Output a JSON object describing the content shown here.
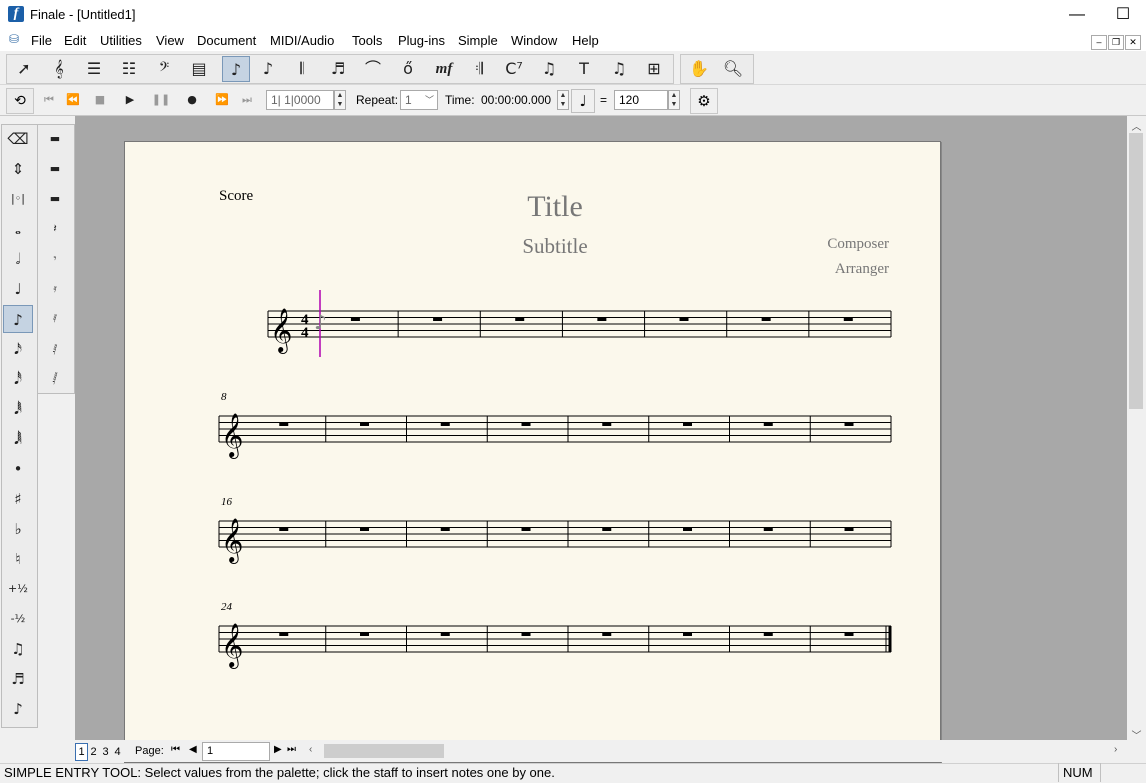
{
  "window": {
    "title": "Finale - [Untitled1]",
    "controls": {
      "minimize": "—",
      "maximize": "☐",
      "close": "✕"
    }
  },
  "menu": [
    {
      "label": "File"
    },
    {
      "label": "Edit"
    },
    {
      "label": "Utilities"
    },
    {
      "label": "View"
    },
    {
      "label": "Document"
    },
    {
      "label": "MIDI/Audio"
    },
    {
      "label": "Tools"
    },
    {
      "label": "Plug-ins"
    },
    {
      "label": "Simple"
    },
    {
      "label": "Window"
    },
    {
      "label": "Help"
    }
  ],
  "main_tools": [
    {
      "name": "selection-tool-icon",
      "glyph": "➚"
    },
    {
      "name": "staff-tool-icon",
      "glyph": "𝄞"
    },
    {
      "name": "smart-shape-staff-icon",
      "glyph": "☰"
    },
    {
      "name": "measure-tool-icon",
      "glyph": "☷"
    },
    {
      "name": "clef-tool-icon",
      "glyph": "𝄢"
    },
    {
      "name": "key-signature-tool-icon",
      "glyph": "▤"
    },
    {
      "name": "simple-entry-tool-icon",
      "glyph": "♪",
      "active": true
    },
    {
      "name": "speedy-entry-tool-icon",
      "glyph": "♪"
    },
    {
      "name": "tuplet-tool-icon",
      "glyph": "𝄃"
    },
    {
      "name": "tuplet-3-tool-icon",
      "glyph": "♬"
    },
    {
      "name": "smart-shape-tool-icon",
      "glyph": "⌒"
    },
    {
      "name": "articulation-tool-icon",
      "glyph": "ő"
    },
    {
      "name": "expression-tool-icon",
      "glyph": "mf",
      "serif": true
    },
    {
      "name": "repeat-tool-icon",
      "glyph": "𝄇"
    },
    {
      "name": "chord-tool-icon",
      "glyph": "C⁷"
    },
    {
      "name": "lyrics-tool-icon",
      "glyph": "♫"
    },
    {
      "name": "text-tool-icon",
      "glyph": "T"
    },
    {
      "name": "resize-tool-icon",
      "glyph": "♫"
    },
    {
      "name": "page-layout-tool-icon",
      "glyph": "⊞"
    },
    {
      "name": "hand-grabber-icon",
      "glyph": "✋"
    },
    {
      "name": "zoom-icon",
      "glyph": "🔍︎"
    }
  ],
  "playback": {
    "loop_glyph": "⟲",
    "buttons": [
      {
        "name": "rewind-start-icon",
        "glyph": "⏮",
        "on": false
      },
      {
        "name": "rewind-icon",
        "glyph": "⏪",
        "on": false
      },
      {
        "name": "stop-icon",
        "glyph": "■",
        "on": false
      },
      {
        "name": "play-icon",
        "glyph": "▶",
        "on": true
      },
      {
        "name": "pause-icon",
        "glyph": "❚❚",
        "on": false
      },
      {
        "name": "record-icon",
        "glyph": "●",
        "on": true
      },
      {
        "name": "fast-forward-icon",
        "glyph": "⏩",
        "on": false
      },
      {
        "name": "forward-end-icon",
        "glyph": "⏭",
        "on": false
      }
    ],
    "counter": "1|  1|0000",
    "repeat_label": "Repeat:",
    "repeat_value": "1",
    "time_label": "Time:",
    "time_value": "00:00:00.000",
    "tempo_equals": "=",
    "tempo_value": "120",
    "settings_glyph": "⚙"
  },
  "palette_main": [
    {
      "name": "eraser-icon",
      "glyph": "⌫"
    },
    {
      "name": "pitch-up-down-icon",
      "glyph": "⇕"
    },
    {
      "name": "breve-icon",
      "glyph": "|◦|"
    },
    {
      "name": "whole-note-icon",
      "glyph": "𝅝"
    },
    {
      "name": "half-note-icon",
      "glyph": "𝅗𝅥"
    },
    {
      "name": "quarter-note-icon",
      "glyph": "♩"
    },
    {
      "name": "eighth-note-icon",
      "glyph": "♪",
      "active": true
    },
    {
      "name": "sixteenth-note-icon",
      "glyph": "𝅘𝅥𝅯"
    },
    {
      "name": "thirty-second-note-icon",
      "glyph": "𝅘𝅥𝅰"
    },
    {
      "name": "sixty-fourth-note-icon",
      "glyph": "𝅘𝅥𝅱"
    },
    {
      "name": "one-twenty-eighth-note-icon",
      "glyph": "𝅘𝅥𝅲"
    },
    {
      "name": "dot-icon",
      "glyph": "•"
    },
    {
      "name": "sharp-icon",
      "glyph": "♯"
    },
    {
      "name": "flat-icon",
      "glyph": "♭"
    },
    {
      "name": "natural-icon",
      "glyph": "♮"
    },
    {
      "name": "half-step-up-icon",
      "glyph": "+½"
    },
    {
      "name": "half-step-down-icon",
      "glyph": "-½"
    },
    {
      "name": "tie-icon",
      "glyph": "♫"
    },
    {
      "name": "tuplet-palette-icon",
      "glyph": "♬"
    },
    {
      "name": "grace-note-icon",
      "glyph": "♪"
    }
  ],
  "palette_rests": [
    {
      "name": "whole-rest-icon",
      "glyph": "▬"
    },
    {
      "name": "half-rest-icon",
      "glyph": "▬"
    },
    {
      "name": "breve-rest-icon",
      "glyph": "▬"
    },
    {
      "name": "quarter-rest-icon",
      "glyph": "𝄽"
    },
    {
      "name": "eighth-rest-icon",
      "glyph": "𝄾"
    },
    {
      "name": "sixteenth-rest-icon",
      "glyph": "𝄿"
    },
    {
      "name": "thirty-second-rest-icon",
      "glyph": "𝅀"
    },
    {
      "name": "sixty-fourth-rest-icon",
      "glyph": "𝅁"
    },
    {
      "name": "one-twenty-eighth-rest-icon",
      "glyph": "𝅂"
    }
  ],
  "score": {
    "label": "Score",
    "title": "Title",
    "subtitle": "Subtitle",
    "composer": "Composer",
    "arranger": "Arranger",
    "time_signature": {
      "numerator": "4",
      "denominator": "4"
    },
    "systems": [
      {
        "start_measure": "",
        "measures": 7
      },
      {
        "start_measure": "8",
        "measures": 8
      },
      {
        "start_measure": "16",
        "measures": 8
      },
      {
        "start_measure": "24",
        "measures": 8,
        "final_barline": true
      }
    ]
  },
  "pager": {
    "pages": [
      "1",
      "2",
      "3",
      "4"
    ],
    "active": "1",
    "page_label": "Page:",
    "page_value": "1"
  },
  "status": {
    "text": "SIMPLE ENTRY TOOL: Select values from the palette; click the staff to insert notes one by one.",
    "num": "NUM"
  }
}
